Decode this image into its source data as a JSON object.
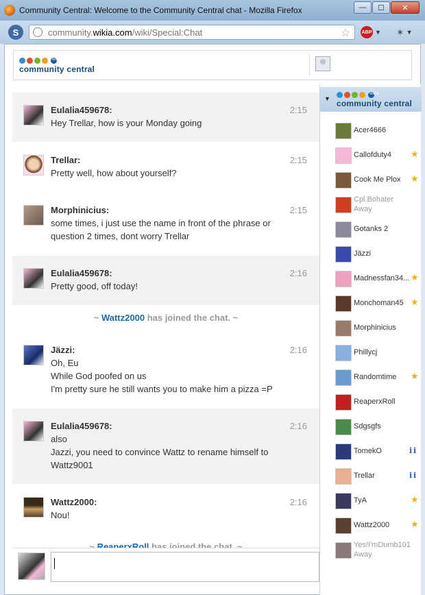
{
  "window": {
    "title": "Community Central: Welcome to the Community Central chat - Mozilla Firefox",
    "minimize": "—",
    "maximize": "☐",
    "close": "✕"
  },
  "browser": {
    "url_prefix": "community.",
    "url_host": "wikia.com",
    "url_path": "/wiki/Special:Chat",
    "star_icon": "☆",
    "nav_icon": "S",
    "abp_label": "ABP",
    "tool_icon": "✶"
  },
  "logo": {
    "text": "community central",
    "badge": "wikia"
  },
  "messages": [
    {
      "user": "Eulalia459678:",
      "time": "2:15",
      "lines": [
        "Hey Trellar, how is your Monday going"
      ],
      "shade": true
    },
    {
      "user": "Trellar:",
      "time": "2:15",
      "lines": [
        "Pretty well, how about yourself?"
      ],
      "shade": false
    },
    {
      "user": "Morphinicius:",
      "time": "2:15",
      "lines": [
        "some times, i just use the name in front of the phrase or",
        "question 2 times, dont worry Trellar"
      ],
      "shade": false
    },
    {
      "user": "Eulalia459678:",
      "time": "2:16",
      "lines": [
        "Pretty good, off today!"
      ],
      "shade": true
    },
    {
      "user": "Jäzzi:",
      "time": "2:16",
      "lines": [
        "Oh, Eu",
        "While God poofed on us",
        "I'm pretty sure he still wants you to make him a pizza =P"
      ],
      "shade": false
    },
    {
      "user": "Eulalia459678:",
      "time": "2:16",
      "lines": [
        "also",
        "Jazzi, you need to convince Wattz to rename himself to",
        "Wattz9001"
      ],
      "shade": true
    },
    {
      "user": "Wattz2000:",
      "time": "2:16",
      "lines": [
        "Nou!"
      ],
      "shade": false
    }
  ],
  "joins": [
    {
      "who": "Wattz2000",
      "text": "has joined the chat."
    },
    {
      "who": "ReaperxRoll",
      "text": "has joined the chat."
    }
  ],
  "join_tilde": "~",
  "users": [
    {
      "name": "Acer4666",
      "badge": ""
    },
    {
      "name": "Callofduty4",
      "badge": "star"
    },
    {
      "name": "Cook Me Plox",
      "badge": "star"
    },
    {
      "name": "Cpl.Bohater",
      "status": "Away",
      "badge": ""
    },
    {
      "name": "Gotanks 2",
      "badge": ""
    },
    {
      "name": "Jäzzi",
      "badge": ""
    },
    {
      "name": "Madnessfan34...",
      "badge": "star"
    },
    {
      "name": "Monchoman45",
      "badge": "star"
    },
    {
      "name": "Morphinicius",
      "badge": ""
    },
    {
      "name": "Phillycj",
      "badge": ""
    },
    {
      "name": "Randomtime",
      "badge": "star"
    },
    {
      "name": "ReaperxRoll",
      "badge": ""
    },
    {
      "name": "Sdgsgfs",
      "badge": ""
    },
    {
      "name": "TomekO",
      "badge": "info"
    },
    {
      "name": "Trellar",
      "badge": "info"
    },
    {
      "name": "TyA",
      "badge": "star"
    },
    {
      "name": "Wattz2000",
      "badge": "star"
    },
    {
      "name": "Yes!I'mDumb101",
      "status": "Away",
      "badge": ""
    }
  ],
  "icons": {
    "star": "★",
    "info": "i i",
    "sidebar_toggle": "▼",
    "scroll_up": "▲",
    "scroll_down": "▼"
  }
}
